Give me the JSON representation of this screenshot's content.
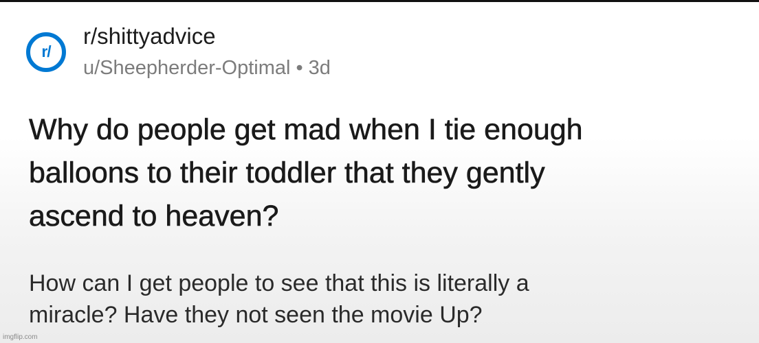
{
  "post": {
    "subreddit_icon_text": "r/",
    "subreddit": "r/shittyadvice",
    "author": "u/Sheepherder-Optimal",
    "separator": "•",
    "age": "3d",
    "title_line1": "Why do people get mad when I tie enough",
    "title_line2": "balloons to their toddler that they gently",
    "title_line3": "ascend to heaven?",
    "body_line1": "How can I get people to see that this is literally a",
    "body_line2": "miracle? Have they not seen the movie Up?"
  },
  "watermark": "imgflip.com",
  "colors": {
    "accent": "#0079d3",
    "text": "#1c1c1c",
    "meta": "#7c7c7c"
  }
}
